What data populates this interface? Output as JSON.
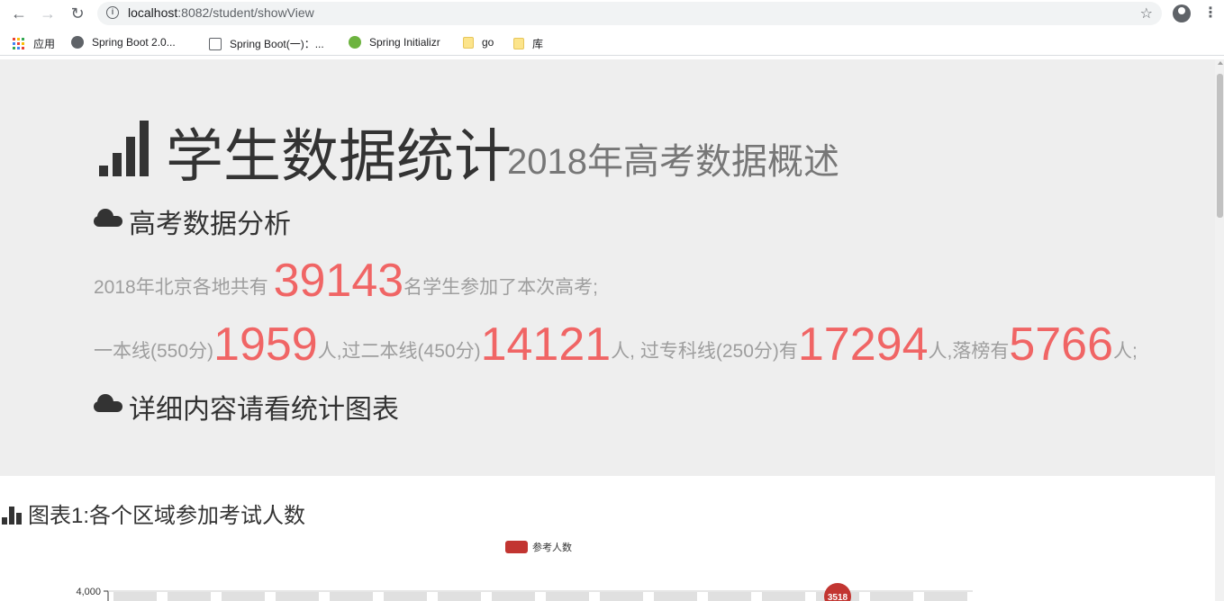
{
  "browser": {
    "url_host": "localhost",
    "url_path": ":8082/student/showView",
    "bookmarks": [
      {
        "label": "应用",
        "icon": "apps-grid-icon"
      },
      {
        "label": "Spring Boot 2.0...",
        "icon": "globe-icon"
      },
      {
        "label": "Spring Boot(一)：...",
        "icon": "page-icon"
      },
      {
        "label": "Spring Initializr",
        "icon": "spring-leaf-icon"
      },
      {
        "label": "go",
        "icon": "folder-icon"
      },
      {
        "label": "库",
        "icon": "folder-icon"
      }
    ]
  },
  "jumbotron": {
    "title": "学生数据统计",
    "subtitle": "2018年高考数据概述",
    "section1": "高考数据分析",
    "line1": {
      "prefix": "2018年北京各地共有 ",
      "total": "39143",
      "suffix": "名学生参加了本次高考;"
    },
    "line2": {
      "t1": "一本线(550分)",
      "v1": "1959",
      "t2": "人,过二本线(450分)",
      "v2": "14121",
      "t3": "人, 过专科线(250分)有",
      "v3": "17294",
      "t4": "人,落榜有",
      "v4": "5766",
      "t5": "人;"
    },
    "section2": "详细内容请看统计图表"
  },
  "chart_section": {
    "title": "图表1:各个区域参加考试人数"
  },
  "colors": {
    "accent": "#f06565",
    "series": "#c23531",
    "background": "#eeeeee"
  },
  "chart_data": {
    "type": "bar",
    "categories": [],
    "series": [
      {
        "name": "参考人数",
        "values": []
      }
    ],
    "ylim": [
      0,
      4000
    ],
    "y_ticks": [
      "4,000"
    ],
    "visible_label": "3518",
    "legend": "top-center"
  }
}
